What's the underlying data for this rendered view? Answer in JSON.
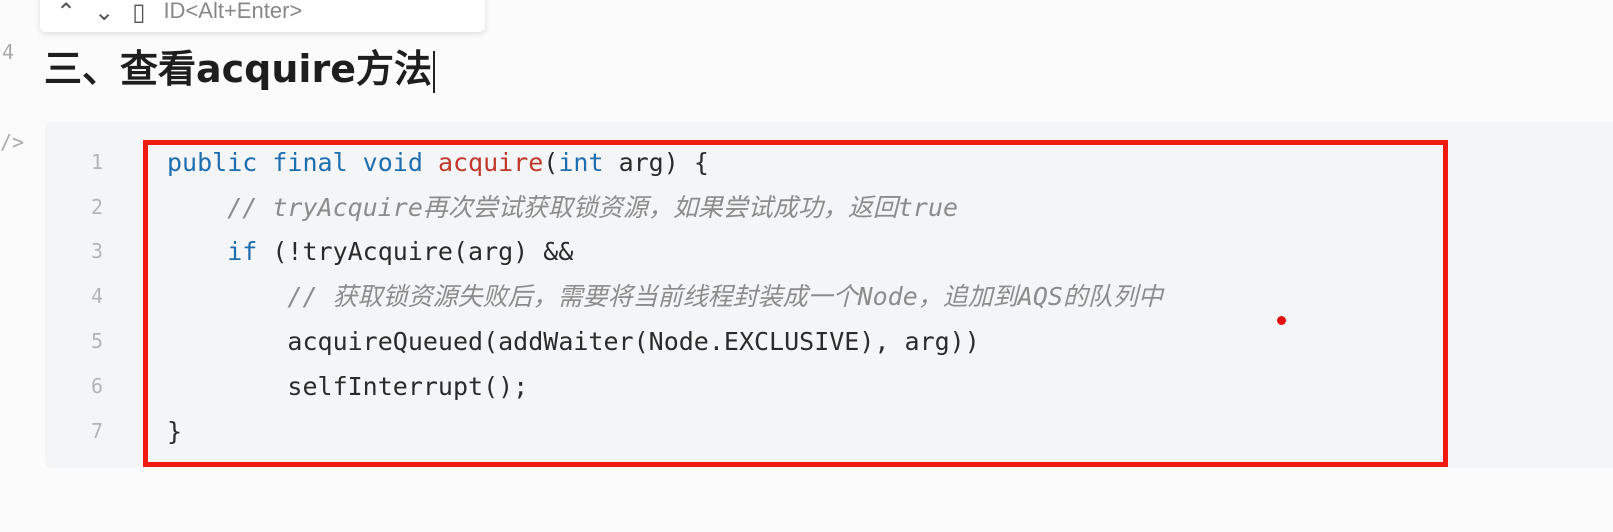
{
  "find_popup": {
    "hint": "ID<Alt+Enter>",
    "icons": [
      "chevron-up-icon",
      "chevron-down-icon",
      "copy-icon"
    ]
  },
  "gutter": {
    "heading_line": "4",
    "code_marker": "/>"
  },
  "heading": "三、查看acquire方法",
  "code": {
    "line_numbers": [
      "1",
      "2",
      "3",
      "4",
      "5",
      "6",
      "7"
    ],
    "lines": {
      "l1": {
        "kw1": "public final void ",
        "fn": "acquire",
        "p1": "(",
        "kw2": "int",
        "rest": " arg) {"
      },
      "l2": {
        "comment": "    // tryAcquire再次尝试获取锁资源，如果尝试成功，返回true"
      },
      "l3": {
        "kw": "    if",
        "rest": " (!tryAcquire(arg) &&"
      },
      "l4": {
        "comment": "        // 获取锁资源失败后，需要将当前线程封装成一个Node，追加到AQS的队列中"
      },
      "l5": {
        "text": "        acquireQueued(addWaiter(Node.EXCLUSIVE), arg))"
      },
      "l6": {
        "text": "        selfInterrupt();"
      },
      "l7": {
        "text": "}"
      }
    }
  },
  "colors": {
    "highlight_border": "#ef1b10",
    "keyword": "#1f6fb0",
    "function": "#c0392b",
    "comment": "#8c8c8c"
  }
}
